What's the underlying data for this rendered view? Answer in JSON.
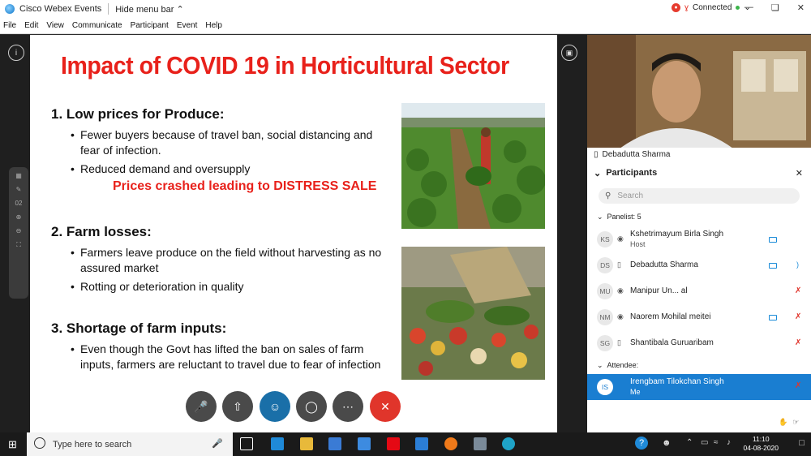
{
  "window": {
    "app_title": "Cisco Webex Events",
    "hide_menu": "Hide menu bar",
    "status": "Connected"
  },
  "menu": [
    "File",
    "Edit",
    "View",
    "Communicate",
    "Participant",
    "Event",
    "Help"
  ],
  "slide": {
    "title": "Impact of COVID 19 in Horticultural Sector",
    "sections": [
      {
        "heading": "1.  Low prices for Produce:",
        "bullets": [
          "Fewer buyers because of travel ban, social distancing and fear of infection.",
          "Reduced demand and oversupply"
        ],
        "highlight": "Prices crashed leading to DISTRESS SALE"
      },
      {
        "heading": "2.  Farm losses:",
        "bullets": [
          "Farmers leave produce on the field without harvesting as no assured market",
          "Rotting or deterioration in quality"
        ]
      },
      {
        "heading": "3.  Shortage of farm inputs:",
        "bullets": [
          "Even though the Govt has lifted the ban on sales of farm inputs, farmers are reluctant to travel due to fear of infection"
        ]
      }
    ]
  },
  "left_tools": {
    "page_num": "02"
  },
  "video": {
    "name": "Debadutta Sharma"
  },
  "participants": {
    "title": "Participants",
    "search_placeholder": "Search",
    "panelist_label": "Panelist: 5",
    "attendee_label": "Attendee:",
    "panelists": [
      {
        "initials": "KS",
        "name": "Kshetrimayum Birla Singh",
        "sub": "Host",
        "cam": true,
        "muted": false
      },
      {
        "initials": "DS",
        "name": "Debadutta Sharma",
        "sub": "",
        "cam": true,
        "muted": false
      },
      {
        "initials": "MU",
        "name": "Manipur Un...       al",
        "sub": "",
        "cam": false,
        "muted": true
      },
      {
        "initials": "NM",
        "name": "Naorem Mohilal meitei",
        "sub": "",
        "cam": true,
        "muted": true
      },
      {
        "initials": "SG",
        "name": "Shantibala Guruaribam",
        "sub": "",
        "cam": false,
        "muted": true
      }
    ],
    "attendees": [
      {
        "initials": "IS",
        "name": "Irengbam Tilokchan Singh",
        "sub": "Me"
      }
    ]
  },
  "taskbar": {
    "search_placeholder": "Type here to search",
    "time": "11:10",
    "date": "04-08-2020"
  },
  "colors": {
    "accent": "#1a7ed1",
    "slide_red": "#e8211b",
    "leave": "#e0352b"
  }
}
